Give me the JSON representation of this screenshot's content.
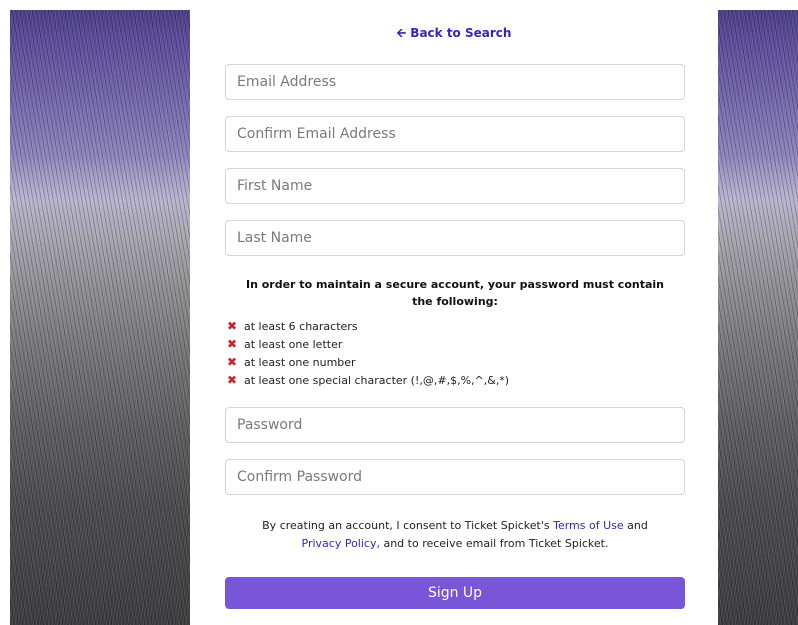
{
  "back_link": {
    "icon": "arrow-left-icon",
    "label": "Back to Search",
    "color": "#3d1fc0"
  },
  "fields": {
    "email": {
      "placeholder": "Email Address",
      "value": ""
    },
    "confirm_email": {
      "placeholder": "Confirm Email Address",
      "value": ""
    },
    "first_name": {
      "placeholder": "First Name",
      "value": ""
    },
    "last_name": {
      "placeholder": "Last Name",
      "value": ""
    },
    "password": {
      "placeholder": "Password",
      "value": ""
    },
    "confirm_password": {
      "placeholder": "Confirm Password",
      "value": ""
    }
  },
  "password_rules": {
    "heading": "In order to maintain a secure account, your password must contain the following:",
    "status_icon": "x-mark-icon",
    "status_color": "#d0202a",
    "items": [
      {
        "label": "at least 6 characters"
      },
      {
        "label": "at least one letter"
      },
      {
        "label": "at least one number"
      },
      {
        "label": "at least one special character (!,@,#,$,%,^,&,*)"
      }
    ]
  },
  "consent": {
    "text_before": "By creating an account, I consent to Ticket Spicket's ",
    "terms_link": "Terms of Use",
    "text_middle": " and ",
    "privacy_link": "Privacy Policy,",
    "text_after": " and to receive email from Ticket Spicket."
  },
  "signup": {
    "label": "Sign Up",
    "color": "#7956d8"
  }
}
